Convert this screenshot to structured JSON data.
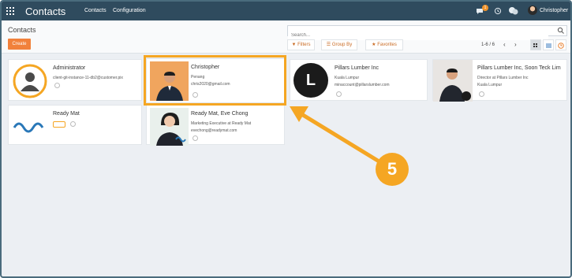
{
  "topbar": {
    "app_title": "Contacts",
    "menu": [
      "Contacts",
      "Configuration"
    ],
    "notification_count": "1",
    "user_name": "Christopher"
  },
  "control": {
    "breadcrumb": "Contacts",
    "create_label": "Create",
    "search_placeholder": "Search...",
    "filters_label": "Filters",
    "group_by_label": "Group By",
    "favorites_label": "Favorites",
    "pager": "1-6 / 6"
  },
  "cards": [
    {
      "name": "Administrator",
      "line1": "client-git-instance-11-db2@customer.pix",
      "line2": ""
    },
    {
      "name": "Christopher",
      "line1": "Penang",
      "line2": "chris2020@gmail.com"
    },
    {
      "name": "Pillars Lumber Inc",
      "line1": "Kuala Lumpur",
      "line2": "minaccount@pillarslumber.com"
    },
    {
      "name": "Pillars Lumber Inc, Soon Teck Lim",
      "line1": "Director at Pillars Lumber Inc",
      "line2": "Kuala Lumpur"
    },
    {
      "name": "Ready Mat",
      "line1": "",
      "line2": ""
    },
    {
      "name": "Ready Mat, Eve Chong",
      "line1": "Marketing Executive at Ready Mat",
      "line2": "evechong@readymat.com"
    }
  ],
  "letter_avatar": "L",
  "annotation": {
    "step": "5"
  },
  "colors": {
    "accent": "#f5a623",
    "topbar": "#2f4b5e",
    "primary": "#f1813b"
  }
}
